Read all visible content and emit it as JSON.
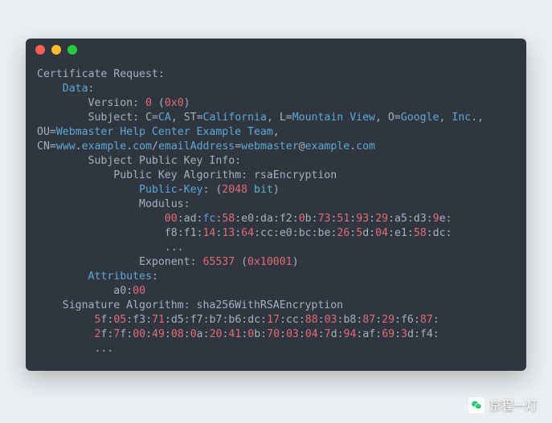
{
  "cert": {
    "header": "Certificate Request",
    "data_label": "Data",
    "version_label": "Version",
    "version_value": "0",
    "version_hex": "0x0",
    "subject_label": "Subject",
    "subject": {
      "c_key": "C",
      "c_val": "CA",
      "st_key": "ST",
      "st_val": "California",
      "l_key": "L",
      "l_val": "Mountain View",
      "o_key": "O",
      "o_val": "Google",
      "inc": "Inc",
      "ou_key": "OU",
      "ou_val": "Webmaster Help Center Example Team",
      "cn_key": "CN",
      "cn_www": "www",
      "cn_example": "example",
      "cn_com": "com",
      "email_key": "emailAddress",
      "email_user": "webmaster",
      "email_dom": "example",
      "email_tld": "com"
    },
    "spki_label": "Subject Public Key Info",
    "pka_label": "Public Key Algorithm",
    "pka_value": "rsaEncryption",
    "pk_label": "Public",
    "key_label": "Key",
    "pk_bits": "2048",
    "pk_bit_word": "bit",
    "modulus_label": "Modulus",
    "modulus_rows": [
      [
        [
          "r",
          "00"
        ],
        [
          "g",
          "ad"
        ],
        [
          "fn",
          "fc"
        ],
        [
          "r",
          "58"
        ],
        [
          "g",
          "e0"
        ],
        [
          "g",
          "da"
        ],
        [
          "g",
          "f2"
        ],
        [
          "r",
          "0"
        ],
        [
          "g",
          "b",
          true
        ],
        [
          "r",
          "73"
        ],
        [
          "r",
          "51"
        ],
        [
          "r",
          "93"
        ],
        [
          "r",
          "29"
        ],
        [
          "g",
          "a5"
        ],
        [
          "g",
          "d3"
        ],
        [
          "r",
          "9"
        ],
        [
          "g",
          "e",
          true
        ]
      ],
      [
        [
          "g",
          "f8"
        ],
        [
          "g",
          "f1"
        ],
        [
          "r",
          "14"
        ],
        [
          "r",
          "13"
        ],
        [
          "r",
          "64"
        ],
        [
          "g",
          "cc"
        ],
        [
          "g",
          "e0"
        ],
        [
          "g",
          "bc"
        ],
        [
          "g",
          "be"
        ],
        [
          "r",
          "26"
        ],
        [
          "r",
          "5"
        ],
        [
          "g",
          "d",
          true
        ],
        [
          "r",
          "04"
        ],
        [
          "g",
          "e1"
        ],
        [
          "r",
          "58"
        ],
        [
          "g",
          "dc"
        ]
      ]
    ],
    "ellipsis": "...",
    "exponent_label": "Exponent",
    "exponent_value": "65537",
    "exponent_hex": "0x10001",
    "attributes_label": "Attributes",
    "attr_key": "a0",
    "attr_val": "00",
    "sig_label": "Signature Algorithm",
    "sig_value": "sha256WithRSAEncryption",
    "sig_rows": [
      [
        [
          "r",
          "5"
        ],
        [
          "g",
          "f",
          true
        ],
        [
          "r",
          "05"
        ],
        [
          "g",
          "f3"
        ],
        [
          "r",
          "71"
        ],
        [
          "g",
          "d5"
        ],
        [
          "g",
          "f7"
        ],
        [
          "g",
          "b7"
        ],
        [
          "g",
          "b6"
        ],
        [
          "g",
          "dc"
        ],
        [
          "r",
          "17"
        ],
        [
          "g",
          "cc"
        ],
        [
          "r",
          "88"
        ],
        [
          "r",
          "03"
        ],
        [
          "g",
          "b8"
        ],
        [
          "r",
          "87"
        ],
        [
          "r",
          "29"
        ],
        [
          "g",
          "f6"
        ],
        [
          "r",
          "87"
        ]
      ],
      [
        [
          "r",
          "2"
        ],
        [
          "g",
          "f",
          true
        ],
        [
          "r",
          "7"
        ],
        [
          "g",
          "f",
          true
        ],
        [
          "r",
          "00"
        ],
        [
          "r",
          "49"
        ],
        [
          "r",
          "08"
        ],
        [
          "r",
          "0"
        ],
        [
          "g",
          "a",
          true
        ],
        [
          "r",
          "20"
        ],
        [
          "r",
          "41"
        ],
        [
          "r",
          "0"
        ],
        [
          "g",
          "b",
          true
        ],
        [
          "r",
          "70"
        ],
        [
          "r",
          "03"
        ],
        [
          "r",
          "04"
        ],
        [
          "r",
          "7"
        ],
        [
          "g",
          "d",
          true
        ],
        [
          "r",
          "94"
        ],
        [
          "g",
          "af"
        ],
        [
          "r",
          "69"
        ],
        [
          "r",
          "3"
        ],
        [
          "g",
          "d",
          true
        ],
        [
          "g",
          "f4"
        ]
      ]
    ]
  },
  "watermark": {
    "text": "京程一灯"
  }
}
